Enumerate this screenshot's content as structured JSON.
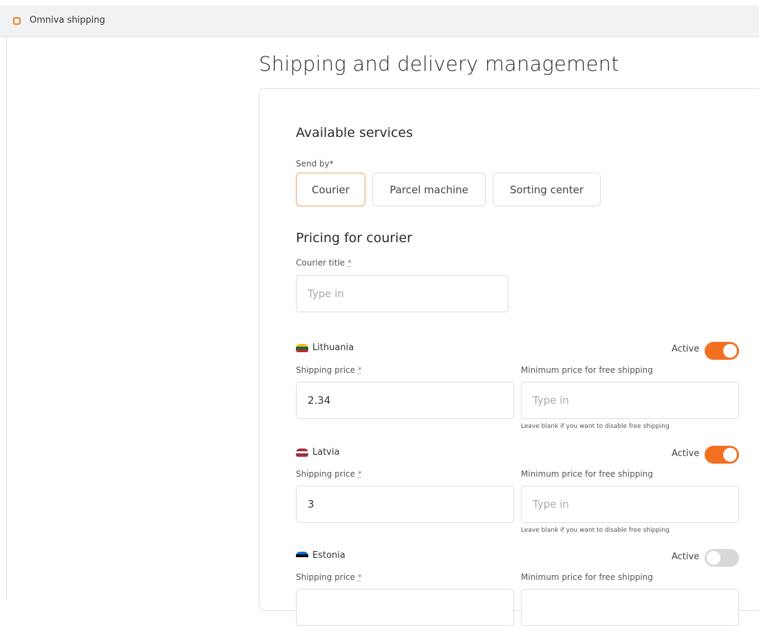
{
  "topbar": {
    "title": "Omniva shipping",
    "icon": "omniva-app-icon",
    "accent": "#f07a19"
  },
  "page": {
    "title": "Shipping and delivery management"
  },
  "services": {
    "title": "Available services",
    "send_by_label": "Send by*",
    "options": [
      "Courier",
      "Parcel machine",
      "Sorting center"
    ],
    "selected": "Courier"
  },
  "pricing": {
    "title": "Pricing for courier",
    "courier_title_label": "Courier title",
    "required_mark": "*",
    "courier_title_placeholder": "Type in",
    "courier_title_value": "",
    "shipping_price_label": "Shipping price",
    "free_label": "Minimum price for free shipping",
    "free_placeholder": "Type in",
    "active_label": "Active",
    "hint": "Leave blank if you want to disable free shipping",
    "toggle_on_color": "#f37021",
    "countries": [
      {
        "name": "Lithuania",
        "price": "2.34",
        "free": "",
        "active": true
      },
      {
        "name": "Latvia",
        "price": "3",
        "free": "",
        "active": true
      },
      {
        "name": "Estonia",
        "price": "",
        "free": "",
        "active": false
      }
    ]
  }
}
